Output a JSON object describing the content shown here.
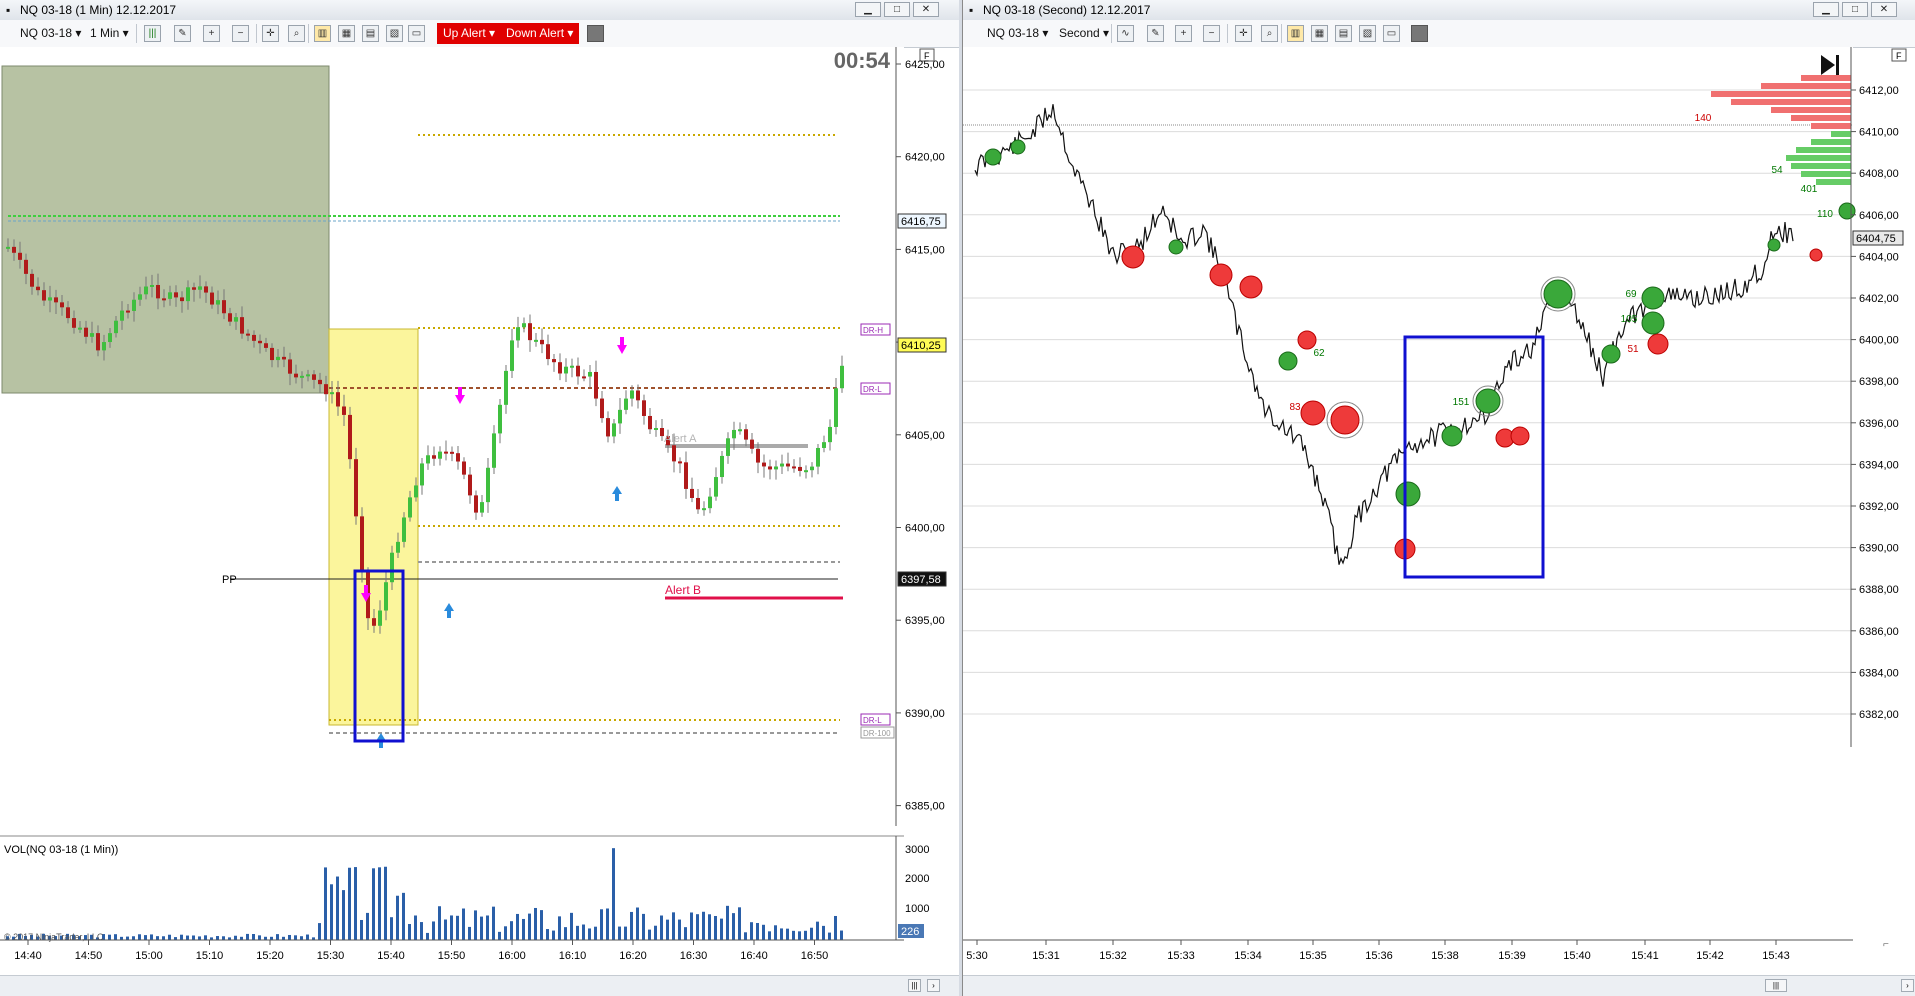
{
  "left": {
    "title": "NQ 03-18 (1 Min)  12.12.2017",
    "instrument": "NQ 03-18",
    "interval": "1 Min",
    "up_alert": "Up Alert",
    "down_alert": "Down Alert",
    "clock": "00:54",
    "f_button": "F",
    "yticks": [
      "6425,00",
      "6420,00",
      "6415,00",
      "6410,00",
      "6405,00",
      "6400,00",
      "6395,00",
      "6390,00",
      "6385,00"
    ],
    "price_tags": {
      "a": "6416,75",
      "b": "6410,25",
      "c": "6397,58"
    },
    "line_labels": {
      "drh": "DR-H",
      "drl": "DR-L",
      "drl2": "DR-L",
      "dr100": "DR-100",
      "pp": "PP",
      "alert_b": "Alert B",
      "alert_a": "Alert A"
    },
    "vol_label": "VOL(NQ 03-18 (1 Min))",
    "vol_ticks": [
      "3000",
      "2000",
      "1000"
    ],
    "vol_last": "226",
    "copyright": "© 2017 NinjaTrader, LLC",
    "xticks": [
      "14:40",
      "14:50",
      "15:00",
      "15:10",
      "15:20",
      "15:30",
      "15:40",
      "15:50",
      "16:00",
      "16:10",
      "16:20",
      "16:30",
      "16:40",
      "16:50"
    ],
    "colors": {
      "up": "#3fbf3f",
      "down": "#b01a1a",
      "alert": "#e00000"
    }
  },
  "right": {
    "title": "NQ 03-18 (Second)  12.12.2017",
    "instrument": "NQ 03-18",
    "interval": "Second",
    "yticks": [
      "6412,00",
      "6410,00",
      "6408,00",
      "6406,00",
      "6404,00",
      "6402,00",
      "6400,00",
      "6398,00",
      "6396,00",
      "6394,00",
      "6392,00",
      "6390,00",
      "6388,00",
      "6386,00",
      "6384,00",
      "6382,00"
    ],
    "last_price": "6404,75",
    "xticks": [
      "5:30",
      "15:31",
      "15:32",
      "15:33",
      "15:34",
      "15:35",
      "15:36",
      "15:38",
      "15:39",
      "15:40",
      "15:41",
      "15:42",
      "15:43"
    ],
    "bubble_labels": [
      "140",
      "54",
      "401",
      "110",
      "69",
      "105",
      "51",
      "62",
      "83",
      "151"
    ]
  }
}
